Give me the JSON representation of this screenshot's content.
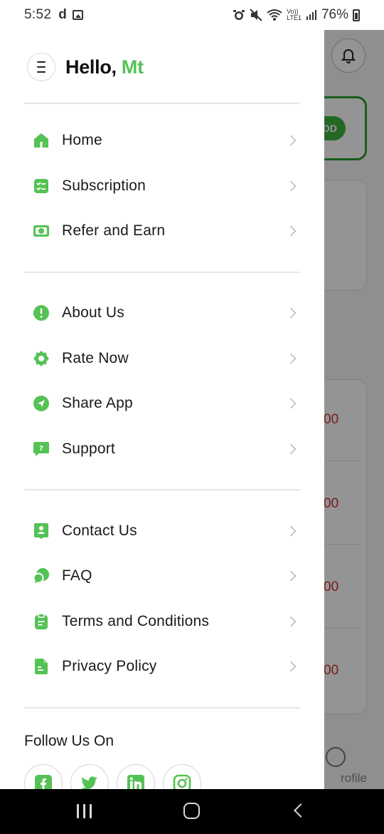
{
  "status_bar": {
    "time": "5:52",
    "left_glyph": "d",
    "battery": "76%",
    "net_label_top": "Vo))",
    "net_label_bottom": "LTE1"
  },
  "background": {
    "pill_text": "DD",
    "prices": [
      "00",
      "00",
      "00",
      "00"
    ],
    "profile_label": "rofile"
  },
  "drawer": {
    "greeting": "Hello,",
    "user_name": "Mt",
    "groups": [
      [
        {
          "label": "Home",
          "icon": "home-icon"
        },
        {
          "label": "Subscription",
          "icon": "subscription-icon"
        },
        {
          "label": "Refer and Earn",
          "icon": "money-icon"
        }
      ],
      [
        {
          "label": "About Us",
          "icon": "info-icon"
        },
        {
          "label": "Rate Now",
          "icon": "badge-star-icon"
        },
        {
          "label": "Share App",
          "icon": "share-send-icon"
        },
        {
          "label": "Support",
          "icon": "support-chat-icon"
        }
      ],
      [
        {
          "label": "Contact Us",
          "icon": "contact-icon"
        },
        {
          "label": "FAQ",
          "icon": "faq-chat-icon"
        },
        {
          "label": "Terms and Conditions",
          "icon": "clipboard-icon"
        },
        {
          "label": "Privacy Policy",
          "icon": "document-icon"
        }
      ]
    ],
    "follow_title": "Follow Us On",
    "social": [
      "facebook-icon",
      "twitter-icon",
      "linkedin-icon",
      "instagram-icon"
    ]
  },
  "colors": {
    "accent": "#55c255",
    "text": "#1a1a1a",
    "divider": "#e6e6e6"
  }
}
